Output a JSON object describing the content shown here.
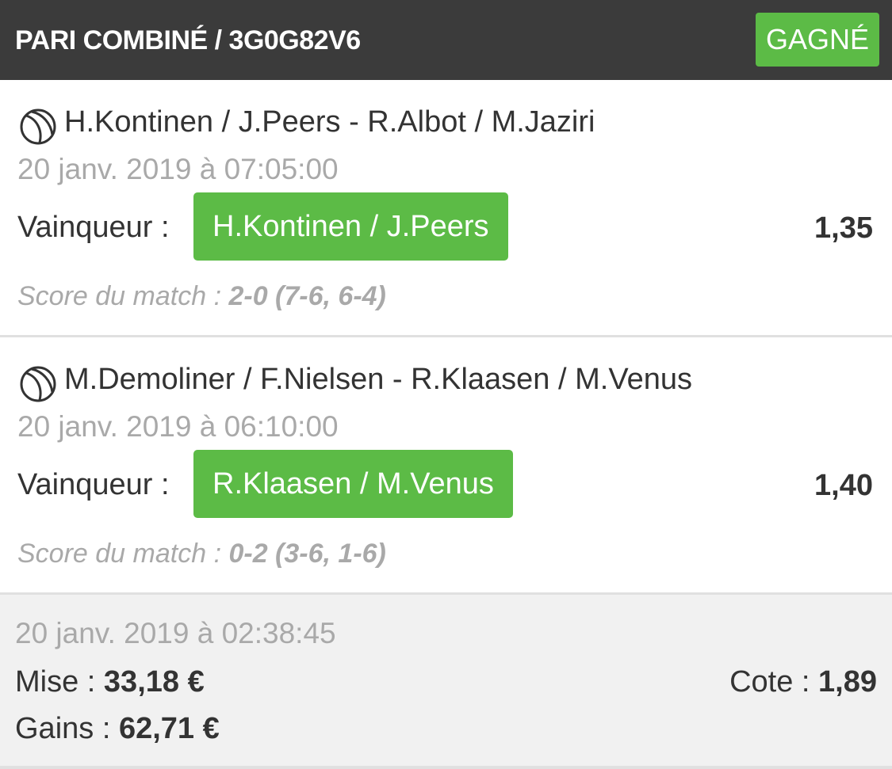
{
  "header": {
    "title": "PARI COMBINÉ / 3G0G82V6",
    "status": "GAGNÉ"
  },
  "colors": {
    "header_bg": "#3b3b3b",
    "win_green": "#5cbb46",
    "muted_text": "#a9a9a9",
    "summary_bg": "#f1f1f1"
  },
  "matches": [
    {
      "sport_icon": "tennis-ball-icon",
      "title": "H.Kontinen / J.Peers - R.Albot / M.Jaziri",
      "datetime": "20 janv. 2019 à 07:05:00",
      "bet_label": "Vainqueur :",
      "selection": "H.Kontinen / J.Peers",
      "odd": "1,35",
      "score_label": "Score du match :",
      "score": "2-0 (7-6, 6-4)"
    },
    {
      "sport_icon": "tennis-ball-icon",
      "title": "M.Demoliner / F.Nielsen - R.Klaasen / M.Venus",
      "datetime": "20 janv. 2019 à 06:10:00",
      "bet_label": "Vainqueur :",
      "selection": "R.Klaasen / M.Venus",
      "odd": "1,40",
      "score_label": "Score du match :",
      "score": "0-2 (3-6, 1-6)"
    }
  ],
  "summary": {
    "datetime": "20 janv. 2019 à 02:38:45",
    "stake_label": "Mise  :",
    "stake_value": "33,18 €",
    "odds_label": "Cote :",
    "odds_value": "1,89",
    "gains_label": "Gains :",
    "gains_value": "62,71 €"
  }
}
